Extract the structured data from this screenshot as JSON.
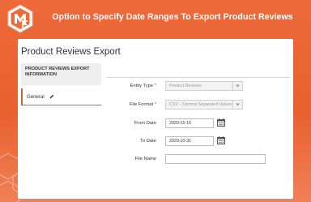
{
  "banner": {
    "title": "Option to Specify Date Ranges To Export Product Reviews",
    "brand_color": "#ee6a3a"
  },
  "page": {
    "title": "Product Reviews Export"
  },
  "sidebar": {
    "section_title": "PRODUCT REVIEWS EXPORT INFORMATION",
    "items": [
      {
        "label": "General",
        "active": true
      }
    ]
  },
  "form": {
    "entity_type": {
      "label": "Entity Type",
      "value": "Product Reviews"
    },
    "file_format": {
      "label": "File Format",
      "value": "CSV - Comma Separated Values"
    },
    "from_date": {
      "label": "From Date",
      "value": "2020-10-16"
    },
    "to_date": {
      "label": "To Date",
      "value": "2020-10-31"
    },
    "file_name": {
      "label": "File Name",
      "value": ""
    }
  }
}
